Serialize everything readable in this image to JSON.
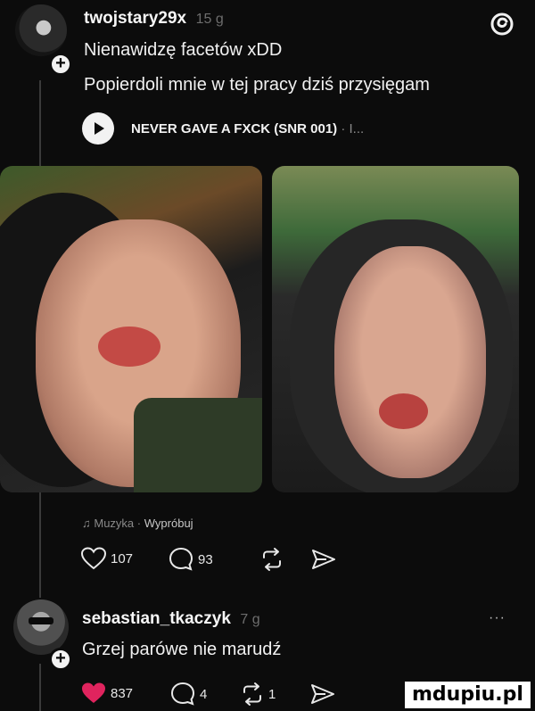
{
  "post1": {
    "username": "twojstary29x",
    "time": "15 g",
    "text_line1": "Nienawidzę facetów xDD",
    "text_line2": "Popierdoli mnie w tej pracy dziś przysięgam",
    "music": {
      "title": "NEVER GAVE A FXCK (SNR 001)",
      "suffix": "· I..."
    },
    "footer": {
      "label": "Muzyka",
      "sep": "·",
      "try": "Wypróbuj"
    },
    "likes": "107",
    "comments": "93"
  },
  "post2": {
    "username": "sebastian_tkaczyk",
    "time": "7 g",
    "more": "···",
    "text": "Grzej parówe nie marudź",
    "likes": "837",
    "comments": "4",
    "reposts": "1"
  },
  "watermark": "mdupiu.pl",
  "colors": {
    "like_red": "#e0245e",
    "background": "#0c0c0c"
  }
}
